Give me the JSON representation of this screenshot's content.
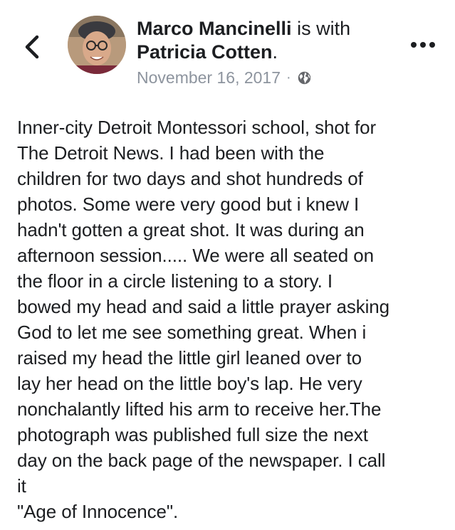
{
  "header": {
    "author": "Marco Mancinelli",
    "with_text": "is with",
    "tagged": "Patricia Cotten",
    "tagged_suffix": ".",
    "date": "November 16, 2017",
    "separator": "·",
    "privacy_icon": "globe-icon",
    "back_icon": "chevron-left-icon",
    "more_icon": "more-dots-icon"
  },
  "post": {
    "text": "Inner-city Detroit Montessori school, shot for\nThe Detroit News. I had been with the\nchildren for two days and shot hundreds of\nphotos. Some were very good but i knew I\nhadn't gotten a great shot. It was during an\nafternoon session..... We were all seated on\nthe floor in a circle listening to a story. I\nbowed my head and said a little prayer asking\nGod to let me see something great. When i\nraised my head the little girl leaned over to\nlay her head on the little boy's lap. He very\nnonchalantly lifted his arm to receive her.The\nphotograph was published full size the next\nday on the back page of the newspaper. I call\nit\n\"Age of Innocence\"."
  },
  "colors": {
    "text": "#1c1e21",
    "meta": "#8d949e",
    "icon": "#1c1e21"
  }
}
